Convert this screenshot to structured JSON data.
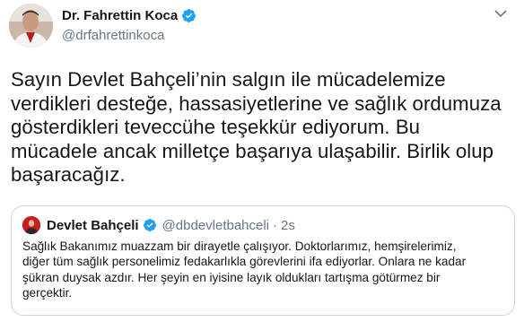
{
  "tweet": {
    "author_name": "Dr. Fahrettin Koca",
    "author_handle": "@drfahrettinkoca",
    "text": "Sayın Devlet Bahçeli’nin salgın ile mücadelemize\nverdikleri desteğe, hassasiyetlerine ve sağlık ordumuza\ngösterdikleri teveccühe teşekkür ediyorum. Bu\nmücadele ancak milletçe başarıya ulaşabilir. Birlik olup\nbaşaracağız."
  },
  "quoted": {
    "author_name": "Devlet Bahçeli",
    "author_handle": "@dbdevletbahceli",
    "separator": "·",
    "time": "2s",
    "text": "Sağlık Bakanımız muazzam bir dirayetle çalışıyor. Doktorlarımız, hemşirelerimiz,\ndiğer tüm sağlık personelimiz fedakarlıkla görevlerini ifa ediyorlar. Onlara ne kadar\nşükran duysak azdır. Her şeyin en iyisine layık oldukları tartışma götürmez bir\ngerçektir."
  },
  "colors": {
    "text": "#14171a",
    "secondary": "#657786",
    "verified": "#1da1f2",
    "border": "#ccd6dd"
  },
  "icons": [
    "verified-badge-icon",
    "more-options-icon"
  ]
}
